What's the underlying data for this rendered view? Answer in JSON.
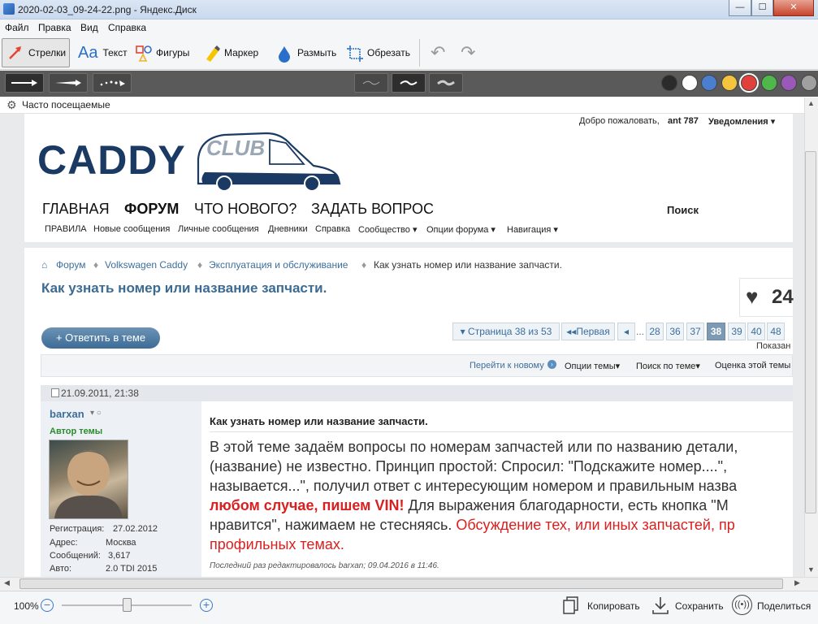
{
  "window": {
    "title": "2020-02-03_09-24-22.png - Яндекс.Диск",
    "min": "—",
    "max": "☐",
    "close": "✕"
  },
  "menu": {
    "file": "Файл",
    "edit": "Правка",
    "view": "Вид",
    "help": "Справка"
  },
  "toolbar": {
    "arrows": "Стрелки",
    "text": "Текст",
    "text_glyph": "Aa",
    "shapes": "Фигуры",
    "marker": "Маркер",
    "blur": "Размыть",
    "crop": "Обрезать",
    "undo_glyph": "↶",
    "redo_glyph": "↷"
  },
  "palette": {
    "colors": [
      "#2b2b2b",
      "#ffffff",
      "#4a7fd0",
      "#f4c53c",
      "#e2403b",
      "#4fb84a",
      "#9a59b8",
      "#a0a0a0"
    ],
    "selected": "#e2403b"
  },
  "bookmarks": {
    "label": "Часто посещаемые"
  },
  "site": {
    "welcome": "Добро пожаловать,",
    "user": "ant 787",
    "notifications": "Уведомления ▾",
    "logo": "CADDY",
    "logo_club": "CLUB",
    "nav": [
      "ГЛАВНАЯ",
      "ФОРУМ",
      "ЧТО НОВОГО?",
      "ЗАДАТЬ ВОПРОС"
    ],
    "search": "Поиск",
    "subnav": [
      "ПРАВИЛА",
      "Новые сообщения",
      "Личные сообщения",
      "Дневники",
      "Справка",
      "Сообщество ▾",
      "Опции форума ▾",
      "Навигация ▾"
    ]
  },
  "breadcrumb": {
    "home_glyph": "⌂",
    "items": [
      "Форум",
      "Volkswagen Caddy",
      "Эксплуатация и обслуживание",
      "Как узнать номер или название запчасти."
    ]
  },
  "thread": {
    "title": "Как узнать номер или название запчасти.",
    "likes": "24",
    "reply_button": "+ Ответить в теме"
  },
  "pagination": {
    "summary": "▾ Страница 38 из 53",
    "first": "◂◂Первая",
    "prev": "◂",
    "ellipsis": "...",
    "pages": [
      "28",
      "36",
      "37",
      "38",
      "39",
      "40",
      "48"
    ],
    "current": "38",
    "shown": "Показан"
  },
  "thread_tools": {
    "goto_new": "Перейти к новому",
    "options": "Опции темы▾",
    "search": "Поиск по теме▾",
    "rating": "Оценка этой темы"
  },
  "post": {
    "date": "21.09.2011, 21:38",
    "author": "barxan",
    "author_role": "Автор темы",
    "info": [
      {
        "label": "Регистрация:",
        "value": "27.02.2012"
      },
      {
        "label": "Адрес:",
        "value": "Москва"
      },
      {
        "label": "Сообщений:",
        "value": "3,617"
      },
      {
        "label": "Авто:",
        "value": "2.0 TDI 2015"
      }
    ],
    "title": "Как узнать номер или название запчасти.",
    "line1": "В этой теме задаём вопросы по номерам запчастей или по названию детали,",
    "line2": "(название) не известно. Принцип простой: Спросил: \"Подскажите номер....\",",
    "line3": "называется...\", получил ответ с интересующим номером и правильным назва",
    "line4_red": "любом случае, пишем VIN!",
    "line4_rest": " Для выражения благодарности, есть кнопка \"М",
    "line5_plain": "нравится\", нажимаем не стесняясь. ",
    "line5_red": "Обсуждение тех, или иных запчастей, пр",
    "line6_red": "профильных темах.",
    "edited": "Последний раз редактировалось barxan; 09.04.2016 в 11:46."
  },
  "statusbar": {
    "zoom": "100%",
    "zoom_level": 0.5,
    "copy": "Копировать",
    "save": "Сохранить",
    "share": "Поделиться"
  }
}
